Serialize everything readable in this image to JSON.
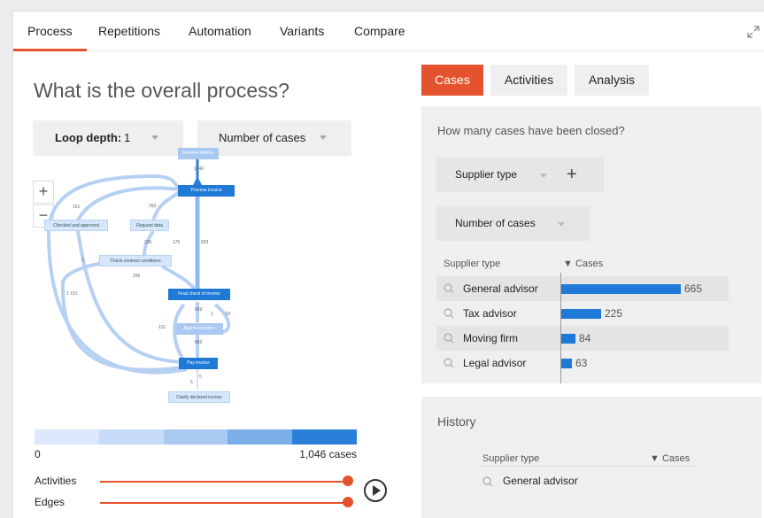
{
  "nav": {
    "tabs": [
      "Process",
      "Repetitions",
      "Automation",
      "Variants",
      "Compare"
    ],
    "active": "Process"
  },
  "left": {
    "question": "What is the overall process?",
    "loop_depth_label": "Loop depth:",
    "loop_depth_value": "1",
    "metric_select": "Number of cases",
    "zoom_in": "+",
    "zoom_out": "−",
    "graph": {
      "nodes": {
        "receive": "Receive invoice",
        "process": "Process invoice",
        "checked": "Checked and approved",
        "request": "Request data",
        "contract": "Check contract conditions",
        "final": "Final check of invoice",
        "approve": "Approve invoice",
        "pay": "Pay invoice",
        "clarify": "Clarify declared invoice"
      },
      "edge_labels": [
        "1046",
        "151",
        "293",
        "289",
        "295",
        "175",
        "829",
        "1",
        "295",
        "1 151",
        "869",
        "1",
        "92",
        "131",
        "869",
        "5",
        "5"
      ]
    },
    "freq_min": "0",
    "freq_max": "1,046 cases",
    "activities_label": "Activities",
    "edges_label": "Edges",
    "activities_value": 1.0,
    "edges_value": 1.0
  },
  "right": {
    "tabs": [
      "Cases",
      "Activities",
      "Analysis"
    ],
    "active": "Cases",
    "question": "How many cases have been closed?",
    "group_select": "Supplier type",
    "add_icon": "+",
    "measure_select": "Number of cases",
    "table": {
      "col1": "Supplier type",
      "col2": "▼ Cases",
      "rows": [
        {
          "label": "General advisor",
          "value": 665
        },
        {
          "label": "Tax advisor",
          "value": 225
        },
        {
          "label": "Moving firm",
          "value": 84
        },
        {
          "label": "Legal advisor",
          "value": 63
        }
      ]
    },
    "history": {
      "title": "History",
      "col1": "Supplier type",
      "col2": "▼ Cases",
      "first_row": "General advisor"
    }
  },
  "colors": {
    "accent": "#e4532d",
    "bar": "#1e7ad6",
    "panel": "#efefef"
  },
  "icons": [
    "expand-icon",
    "search-icon",
    "plus-icon",
    "play-icon",
    "chevron-down-icon"
  ]
}
